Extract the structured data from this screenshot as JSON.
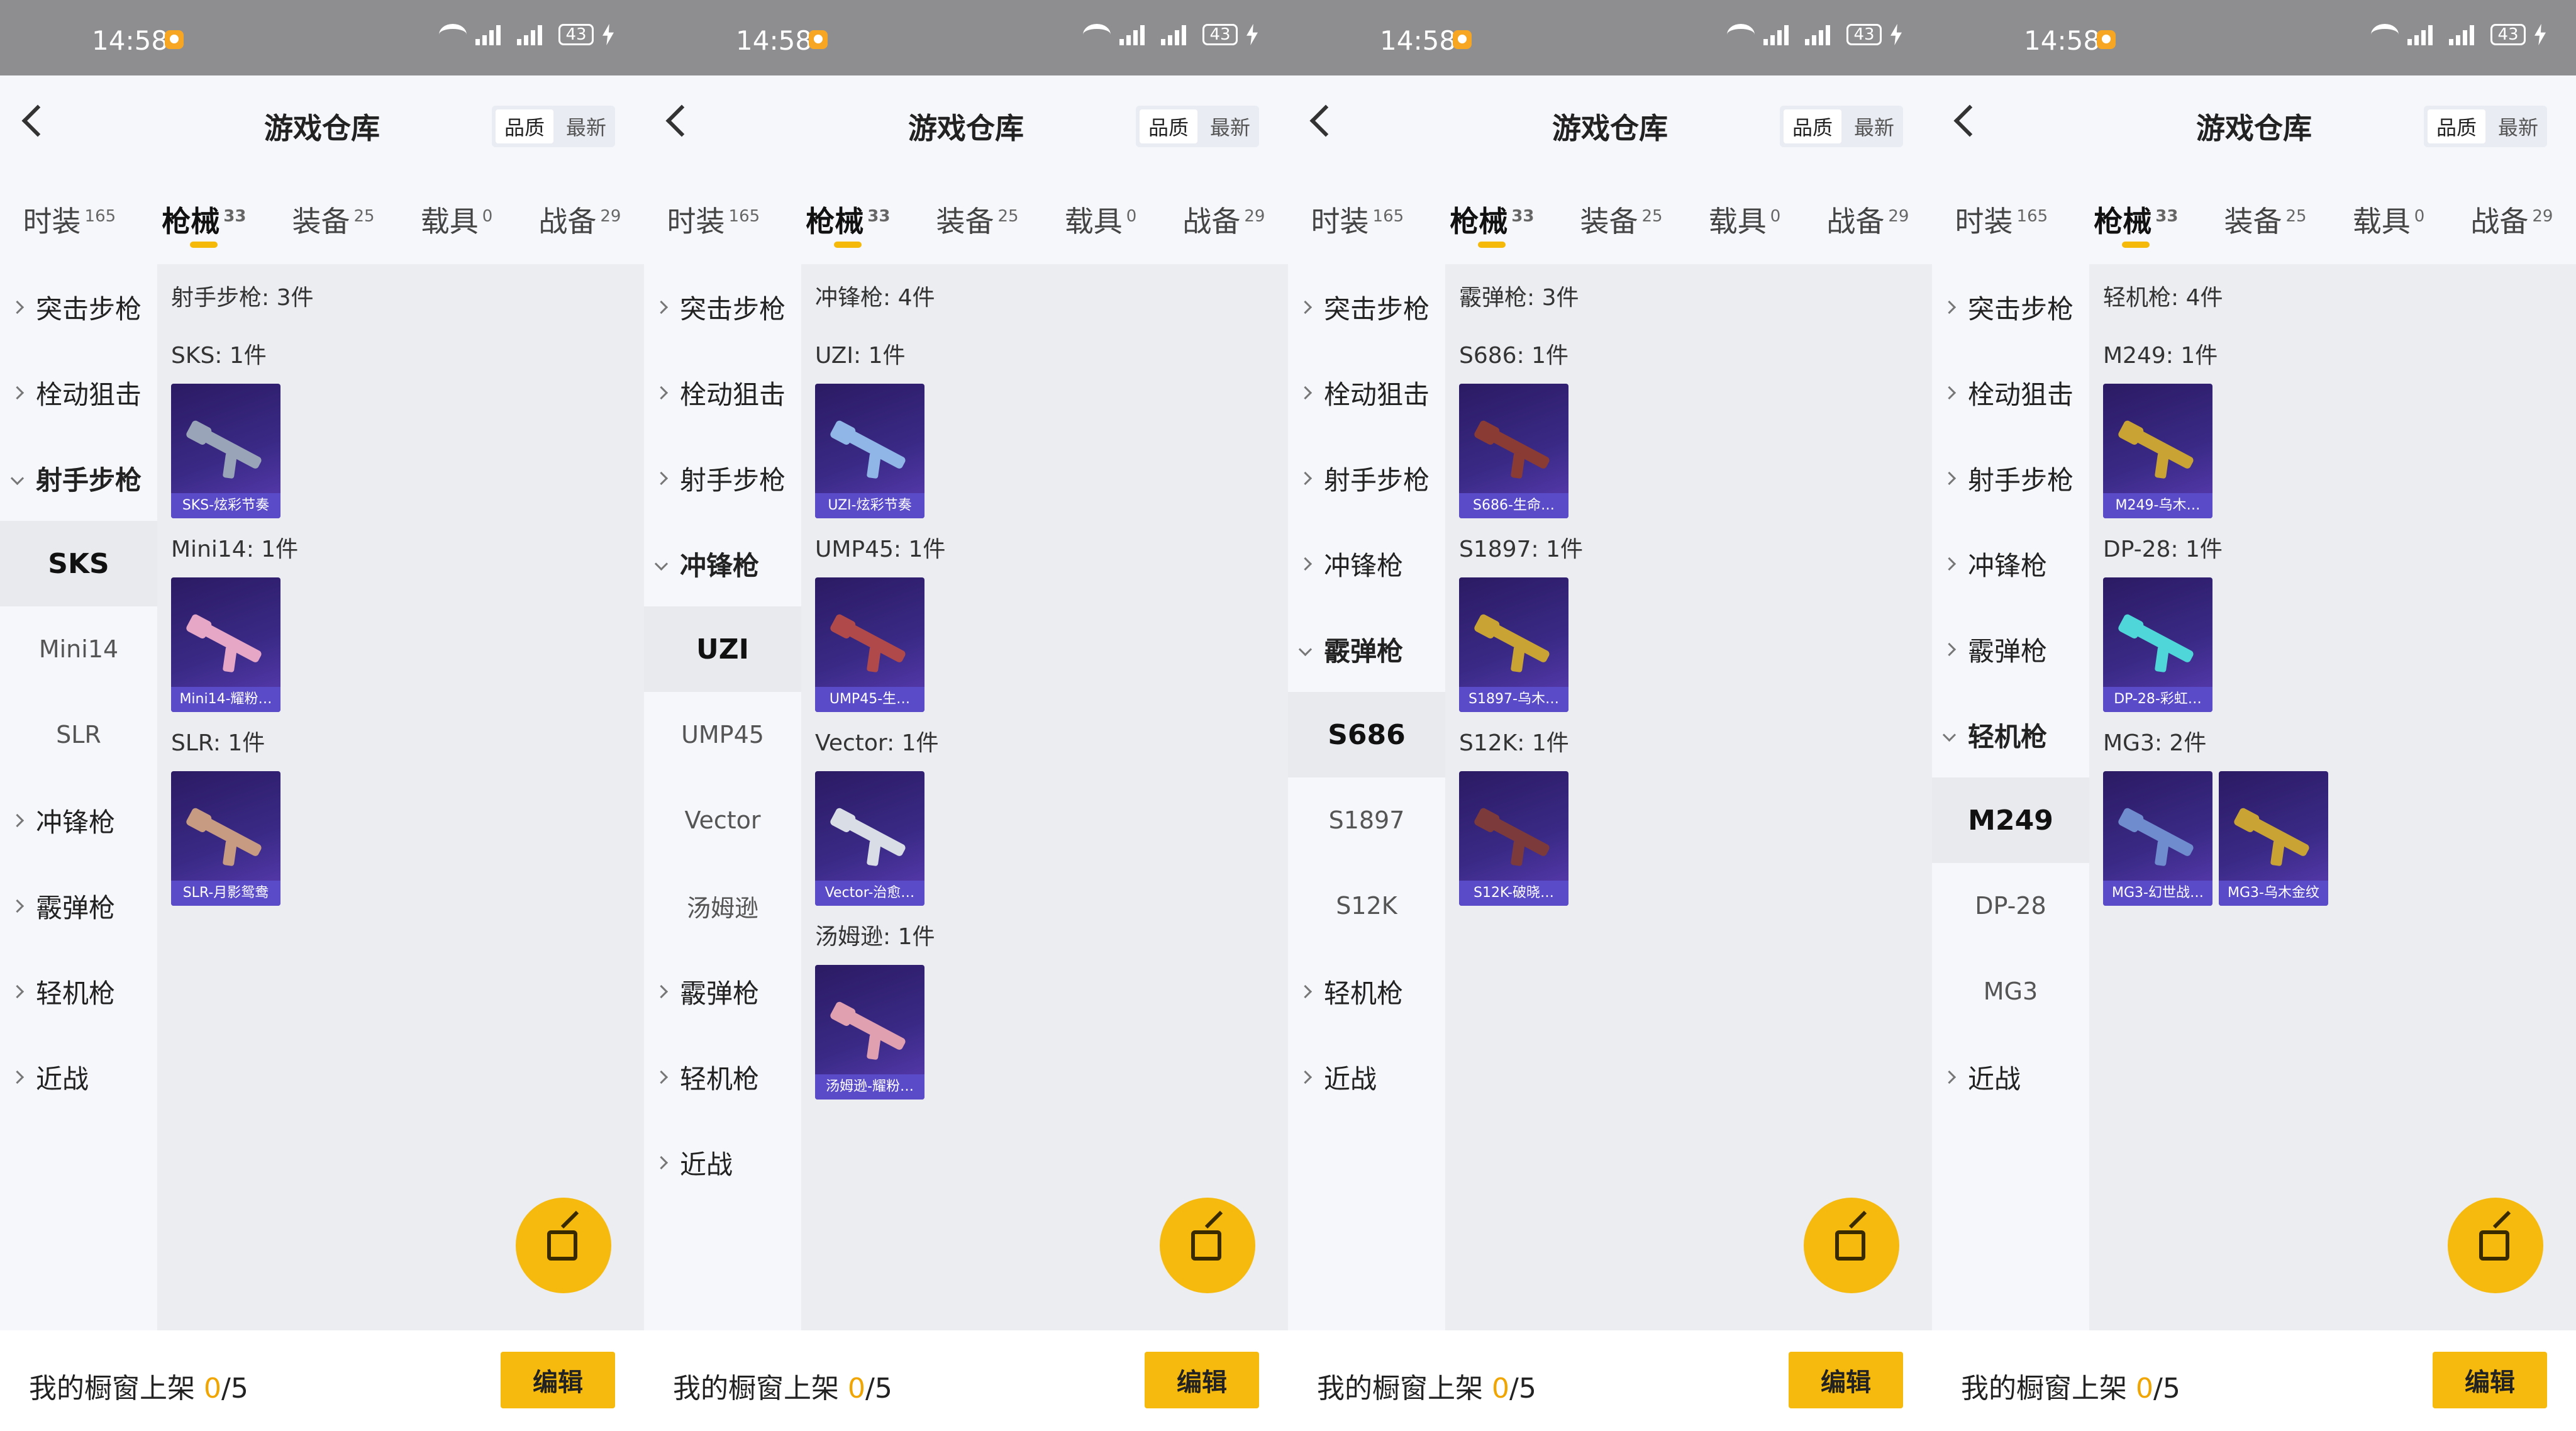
{
  "status": {
    "time": "14:58",
    "signal": "4G",
    "battery": "43"
  },
  "header": {
    "title": "游戏仓库",
    "sort_quality": "品质",
    "sort_newest": "最新"
  },
  "tabs": [
    {
      "label": "时装",
      "count": "165"
    },
    {
      "label": "枪械",
      "count": "33"
    },
    {
      "label": "装备",
      "count": "25"
    },
    {
      "label": "载具",
      "count": "0"
    },
    {
      "label": "战备",
      "count": "29"
    }
  ],
  "footer": {
    "prefix": "我的橱窗上架 ",
    "count": "0",
    "suffix": "/5",
    "edit_label": "编辑"
  },
  "colors": {
    "accent": "#f6b90d",
    "count_color": "#f0a500",
    "card_bg": "#3a2a86"
  },
  "icons": {
    "back": "chevron-left-icon",
    "share": "share-external-icon"
  },
  "panels": [
    {
      "sidebar": [
        {
          "label": "突击步枪",
          "type": "cat"
        },
        {
          "label": "栓动狙击",
          "type": "cat"
        },
        {
          "label": "射手步枪",
          "type": "cat",
          "open": true
        },
        {
          "label": "SKS",
          "type": "sub",
          "selected": true
        },
        {
          "label": "Mini14",
          "type": "sub"
        },
        {
          "label": "SLR",
          "type": "sub"
        },
        {
          "label": "冲锋枪",
          "type": "cat"
        },
        {
          "label": "霰弹枪",
          "type": "cat"
        },
        {
          "label": "轻机枪",
          "type": "cat"
        },
        {
          "label": "近战",
          "type": "cat"
        }
      ],
      "section_title": "射手步枪: 3件",
      "groups": [
        {
          "label": "SKS: 1件",
          "items": [
            {
              "caption": "SKS-炫彩节奏",
              "color": "#9aa4b8"
            }
          ]
        },
        {
          "label": "Mini14: 1件",
          "items": [
            {
              "caption": "Mini14-耀粉…",
              "color": "#e6a7c7"
            }
          ]
        },
        {
          "label": "SLR: 1件",
          "items": [
            {
              "caption": "SLR-月影鸳鸯",
              "color": "#c79a82"
            }
          ]
        }
      ]
    },
    {
      "sidebar": [
        {
          "label": "突击步枪",
          "type": "cat"
        },
        {
          "label": "栓动狙击",
          "type": "cat"
        },
        {
          "label": "射手步枪",
          "type": "cat"
        },
        {
          "label": "冲锋枪",
          "type": "cat",
          "open": true
        },
        {
          "label": "UZI",
          "type": "sub",
          "selected": true
        },
        {
          "label": "UMP45",
          "type": "sub"
        },
        {
          "label": "Vector",
          "type": "sub"
        },
        {
          "label": "汤姆逊",
          "type": "sub"
        },
        {
          "label": "霰弹枪",
          "type": "cat"
        },
        {
          "label": "轻机枪",
          "type": "cat"
        },
        {
          "label": "近战",
          "type": "cat"
        }
      ],
      "section_title": "冲锋枪: 4件",
      "groups": [
        {
          "label": "UZI: 1件",
          "items": [
            {
              "caption": "UZI-炫彩节奏",
              "color": "#8fb6e6"
            }
          ]
        },
        {
          "label": "UMP45: 1件",
          "items": [
            {
              "caption": "UMP45-生…",
              "color": "#b04a4a"
            }
          ]
        },
        {
          "label": "Vector: 1件",
          "items": [
            {
              "caption": "Vector-治愈…",
              "color": "#d9dde6"
            }
          ]
        },
        {
          "label": "汤姆逊: 1件",
          "items": [
            {
              "caption": "汤姆逊-耀粉…",
              "color": "#e0a0b0"
            }
          ]
        }
      ]
    },
    {
      "sidebar": [
        {
          "label": "突击步枪",
          "type": "cat"
        },
        {
          "label": "栓动狙击",
          "type": "cat"
        },
        {
          "label": "射手步枪",
          "type": "cat"
        },
        {
          "label": "冲锋枪",
          "type": "cat"
        },
        {
          "label": "霰弹枪",
          "type": "cat",
          "open": true
        },
        {
          "label": "S686",
          "type": "sub",
          "selected": true
        },
        {
          "label": "S1897",
          "type": "sub"
        },
        {
          "label": "S12K",
          "type": "sub"
        },
        {
          "label": "轻机枪",
          "type": "cat"
        },
        {
          "label": "近战",
          "type": "cat"
        }
      ],
      "section_title": "霰弹枪: 3件",
      "groups": [
        {
          "label": "S686: 1件",
          "items": [
            {
              "caption": "S686-生命…",
              "color": "#8a3b34"
            }
          ]
        },
        {
          "label": "S1897: 1件",
          "items": [
            {
              "caption": "S1897-乌木…",
              "color": "#c9a334"
            }
          ]
        },
        {
          "label": "S12K: 1件",
          "items": [
            {
              "caption": "S12K-破晓…",
              "color": "#7d3a3a"
            }
          ]
        }
      ]
    },
    {
      "sidebar": [
        {
          "label": "突击步枪",
          "type": "cat"
        },
        {
          "label": "栓动狙击",
          "type": "cat"
        },
        {
          "label": "射手步枪",
          "type": "cat"
        },
        {
          "label": "冲锋枪",
          "type": "cat"
        },
        {
          "label": "霰弹枪",
          "type": "cat"
        },
        {
          "label": "轻机枪",
          "type": "cat",
          "open": true
        },
        {
          "label": "M249",
          "type": "sub",
          "selected": true
        },
        {
          "label": "DP-28",
          "type": "sub"
        },
        {
          "label": "MG3",
          "type": "sub"
        },
        {
          "label": "近战",
          "type": "cat"
        }
      ],
      "section_title": "轻机枪: 4件",
      "groups": [
        {
          "label": "M249: 1件",
          "items": [
            {
              "caption": "M249-乌木…",
              "color": "#c9a334"
            }
          ]
        },
        {
          "label": "DP-28: 1件",
          "items": [
            {
              "caption": "DP-28-彩虹…",
              "color": "#4fd6d9"
            }
          ]
        },
        {
          "label": "MG3: 2件",
          "items": [
            {
              "caption": "MG3-幻世战…",
              "color": "#6f8ccf"
            },
            {
              "caption": "MG3-乌木金纹",
              "color": "#c9a334"
            }
          ]
        }
      ]
    }
  ]
}
